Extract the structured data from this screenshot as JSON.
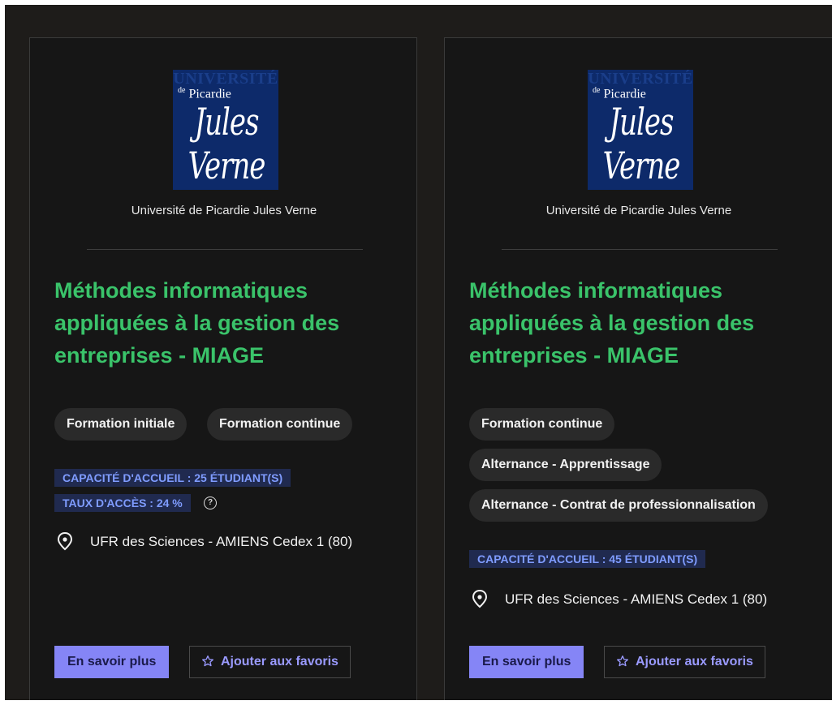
{
  "cards": [
    {
      "logo": {
        "line1": "UNIVERSITÉ",
        "line2_prefix": "de",
        "line2": "Picardie",
        "line3": "Jules Verne"
      },
      "university": "Université de Picardie Jules Verne",
      "title": "Méthodes informatiques appliquées à la gestion des entreprises - MIAGE",
      "tags": [
        "Formation initiale",
        "Formation continue"
      ],
      "capacity": "CAPACITÉ D'ACCUEIL : 25 ÉTUDIANT(S)",
      "access_rate": "TAUX D'ACCÈS : 24 %",
      "help_icon": "?",
      "location": "UFR des Sciences - AMIENS Cedex 1 (80)",
      "more_button": "En savoir plus",
      "favorite_button": "Ajouter aux favoris"
    },
    {
      "logo": {
        "line1": "UNIVERSITÉ",
        "line2_prefix": "de",
        "line2": "Picardie",
        "line3": "Jules Verne"
      },
      "university": "Université de Picardie Jules Verne",
      "title": "Méthodes informatiques appliquées à la gestion des entreprises - MIAGE",
      "tags": [
        "Formation continue",
        "Alternance - Apprentissage",
        "Alternance - Contrat de professionnalisation"
      ],
      "capacity": "CAPACITÉ D'ACCUEIL : 45 ÉTUDIANT(S)",
      "location": "UFR des Sciences - AMIENS Cedex 1 (80)",
      "more_button": "En savoir plus",
      "favorite_button": "Ajouter aux favoris"
    }
  ],
  "colors": {
    "title": "#3ac36a",
    "accent": "#8585f6",
    "badge_text": "#7f9cff",
    "badge_bg": "#202a4f",
    "logo_bg": "#0d2a6a"
  },
  "icons": {
    "location": "map-pin-icon",
    "favorite": "star-outline-icon",
    "help": "question-circle-icon"
  }
}
